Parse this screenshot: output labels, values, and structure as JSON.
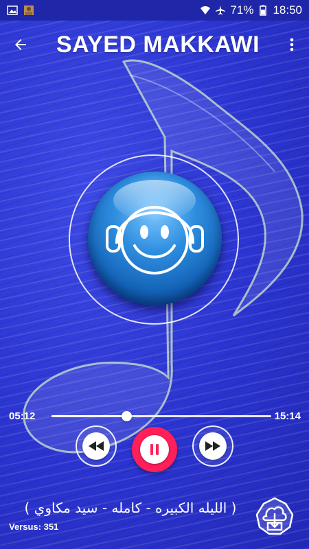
{
  "status_bar": {
    "battery": "71%",
    "time": "18:50"
  },
  "toolbar": {
    "title": "SAYED MAKKAWI"
  },
  "player": {
    "current_time": "05:12",
    "total_time": "15:14",
    "progress": 0.343
  },
  "song": {
    "title": "( الليله الكبيره - كامله - سيد مكاوي )"
  },
  "footer": {
    "version": "Versus: 351"
  },
  "colors": {
    "background": "#2d37d6",
    "play_button": "#ff1f5a",
    "orb": "#2f8ee0"
  }
}
